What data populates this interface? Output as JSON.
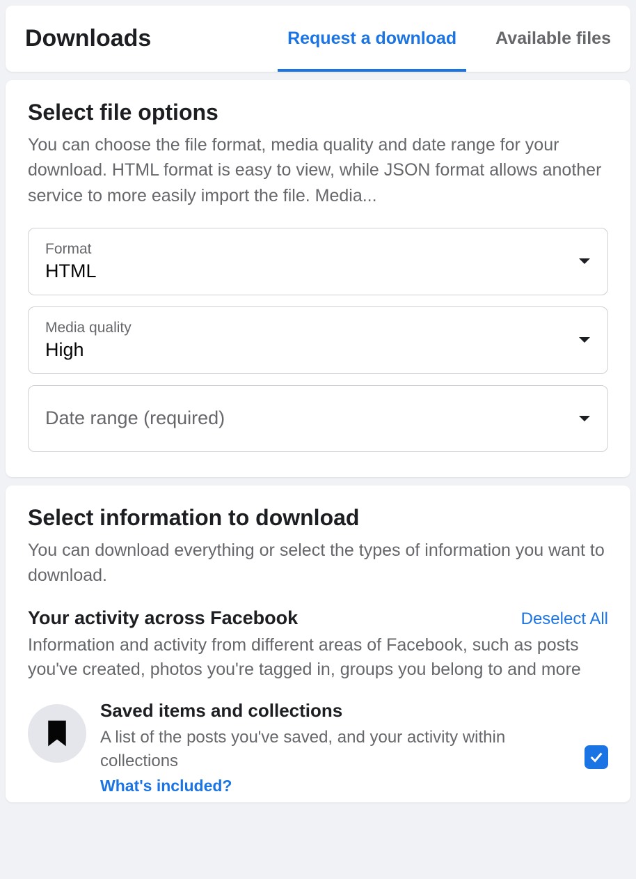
{
  "header": {
    "title": "Downloads",
    "tabs": [
      {
        "label": "Request a download",
        "active": true
      },
      {
        "label": "Available files",
        "active": false
      }
    ]
  },
  "fileOptions": {
    "title": "Select file options",
    "description": "You can choose the file format, media quality and date range for your download. HTML format is easy to view, while JSON format allows another service to more easily import the file. Media...",
    "format": {
      "label": "Format",
      "value": "HTML"
    },
    "mediaQuality": {
      "label": "Media quality",
      "value": "High"
    },
    "dateRange": {
      "placeholder": "Date range (required)"
    }
  },
  "infoSection": {
    "title": "Select information to download",
    "description": "You can download everything or select the types of information you want to download.",
    "activity": {
      "title": "Your activity across Facebook",
      "deselect": "Deselect All",
      "description": "Information and activity from different areas of Facebook, such as posts you've created, photos you're tagged in, groups you belong to and more"
    },
    "items": [
      {
        "title": "Saved items and collections",
        "description": "A list of the posts you've saved, and your activity within collections",
        "link": "What's included?",
        "checked": true
      }
    ]
  }
}
